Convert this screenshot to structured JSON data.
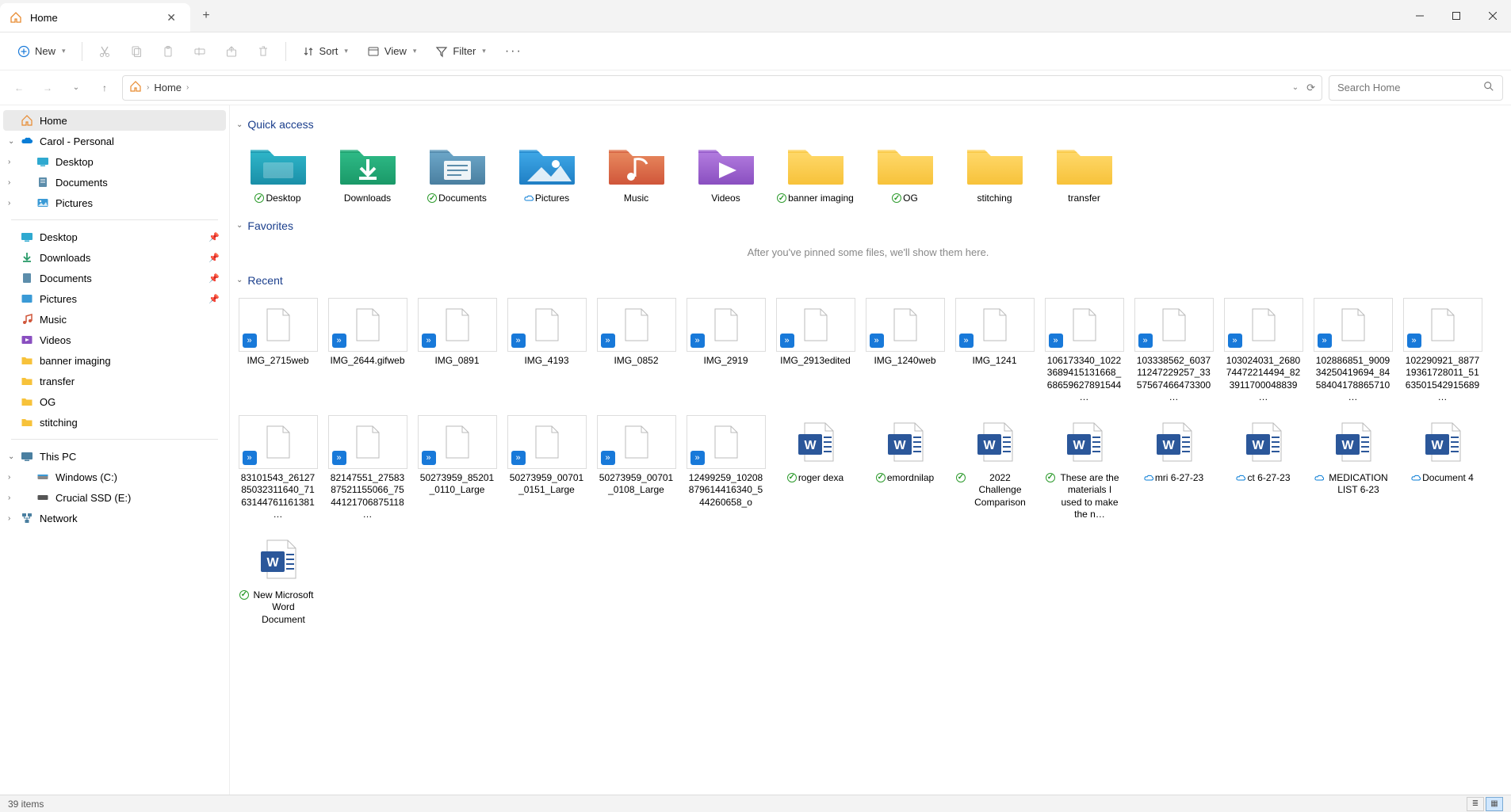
{
  "tab": {
    "title": "Home"
  },
  "toolbar": {
    "new": "New",
    "sort": "Sort",
    "view": "View",
    "filter": "Filter"
  },
  "breadcrumb": {
    "seg0": "Home"
  },
  "search": {
    "placeholder": "Search Home"
  },
  "sidebar": {
    "home": "Home",
    "onedrive": "Carol - Personal",
    "od_desktop": "Desktop",
    "od_documents": "Documents",
    "od_pictures": "Pictures",
    "q_desktop": "Desktop",
    "q_downloads": "Downloads",
    "q_documents": "Documents",
    "q_pictures": "Pictures",
    "q_music": "Music",
    "q_videos": "Videos",
    "q_banner": "banner imaging",
    "q_transfer": "transfer",
    "q_og": "OG",
    "q_stitching": "stitching",
    "thispc": "This PC",
    "drive_c": "Windows  (C:)",
    "drive_e": "Crucial SSD (E:)",
    "network": "Network"
  },
  "sections": {
    "quick_access": "Quick access",
    "favorites": "Favorites",
    "recent": "Recent"
  },
  "favorites_empty": "After you've pinned some files, we'll show them here.",
  "quick_access": [
    {
      "label": "Desktop",
      "kind": "desktop",
      "badge": "green"
    },
    {
      "label": "Downloads",
      "kind": "downloads",
      "badge": null
    },
    {
      "label": "Documents",
      "kind": "documents",
      "badge": "green"
    },
    {
      "label": "Pictures",
      "kind": "pictures",
      "badge": "cloud"
    },
    {
      "label": "Music",
      "kind": "music",
      "badge": null
    },
    {
      "label": "Videos",
      "kind": "videos",
      "badge": null
    },
    {
      "label": "banner imaging",
      "kind": "folder",
      "badge": "green"
    },
    {
      "label": "OG",
      "kind": "folder",
      "badge": "green"
    },
    {
      "label": "stitching",
      "kind": "folder",
      "badge": null
    },
    {
      "label": "transfer",
      "kind": "folder",
      "badge": null
    }
  ],
  "recent": [
    {
      "label": "IMG_2715web",
      "kind": "blank",
      "badge": null
    },
    {
      "label": "IMG_2644.gifweb",
      "kind": "blank",
      "badge": null
    },
    {
      "label": "IMG_0891",
      "kind": "blank",
      "badge": null
    },
    {
      "label": "IMG_4193",
      "kind": "blank",
      "badge": null
    },
    {
      "label": "IMG_0852",
      "kind": "blank",
      "badge": null
    },
    {
      "label": "IMG_2919",
      "kind": "blank",
      "badge": null
    },
    {
      "label": "IMG_2913edited",
      "kind": "blank",
      "badge": null
    },
    {
      "label": "IMG_1240web",
      "kind": "blank",
      "badge": null
    },
    {
      "label": "IMG_1241",
      "kind": "blank",
      "badge": null
    },
    {
      "label": "106173340_10223689415131668_68659627891544…",
      "kind": "blank",
      "badge": null
    },
    {
      "label": "103338562_603711247229257_3357567466473300…",
      "kind": "blank",
      "badge": null
    },
    {
      "label": "103024031_268074472214494_823911700048839…",
      "kind": "blank",
      "badge": null
    },
    {
      "label": "102886851_900934250419694_8458404178865710…",
      "kind": "blank",
      "badge": null
    },
    {
      "label": "102290921_887719361728011_5163501542915689…",
      "kind": "blank",
      "badge": null
    },
    {
      "label": "83101543_2612785032311640_7163144761161381…",
      "kind": "blank",
      "badge": null
    },
    {
      "label": "82147551_2758387521155066_7544121706875118…",
      "kind": "blank",
      "badge": null
    },
    {
      "label": "50273959_85201_0110_Large",
      "kind": "blank",
      "badge": null
    },
    {
      "label": "50273959_00701_0151_Large",
      "kind": "blank",
      "badge": null
    },
    {
      "label": "50273959_00701_0108_Large",
      "kind": "blank",
      "badge": null
    },
    {
      "label": "12499259_10208879614416340_544260658_o",
      "kind": "blank",
      "badge": null
    },
    {
      "label": "roger dexa",
      "kind": "word",
      "badge": "green"
    },
    {
      "label": "emordnilap",
      "kind": "word",
      "badge": "green"
    },
    {
      "label": "2022 Challenge Comparison",
      "kind": "word",
      "badge": "green"
    },
    {
      "label": "These are the materials I used to make the n…",
      "kind": "word",
      "badge": "green"
    },
    {
      "label": "mri 6-27-23",
      "kind": "word",
      "badge": "cloud"
    },
    {
      "label": "ct 6-27-23",
      "kind": "word",
      "badge": "cloud"
    },
    {
      "label": "MEDICATION LIST 6-23",
      "kind": "word",
      "badge": "cloud"
    },
    {
      "label": "Document 4",
      "kind": "word",
      "badge": "cloud"
    },
    {
      "label": "New Microsoft Word Document",
      "kind": "word",
      "badge": "green"
    }
  ],
  "status": {
    "items": "39 items"
  }
}
